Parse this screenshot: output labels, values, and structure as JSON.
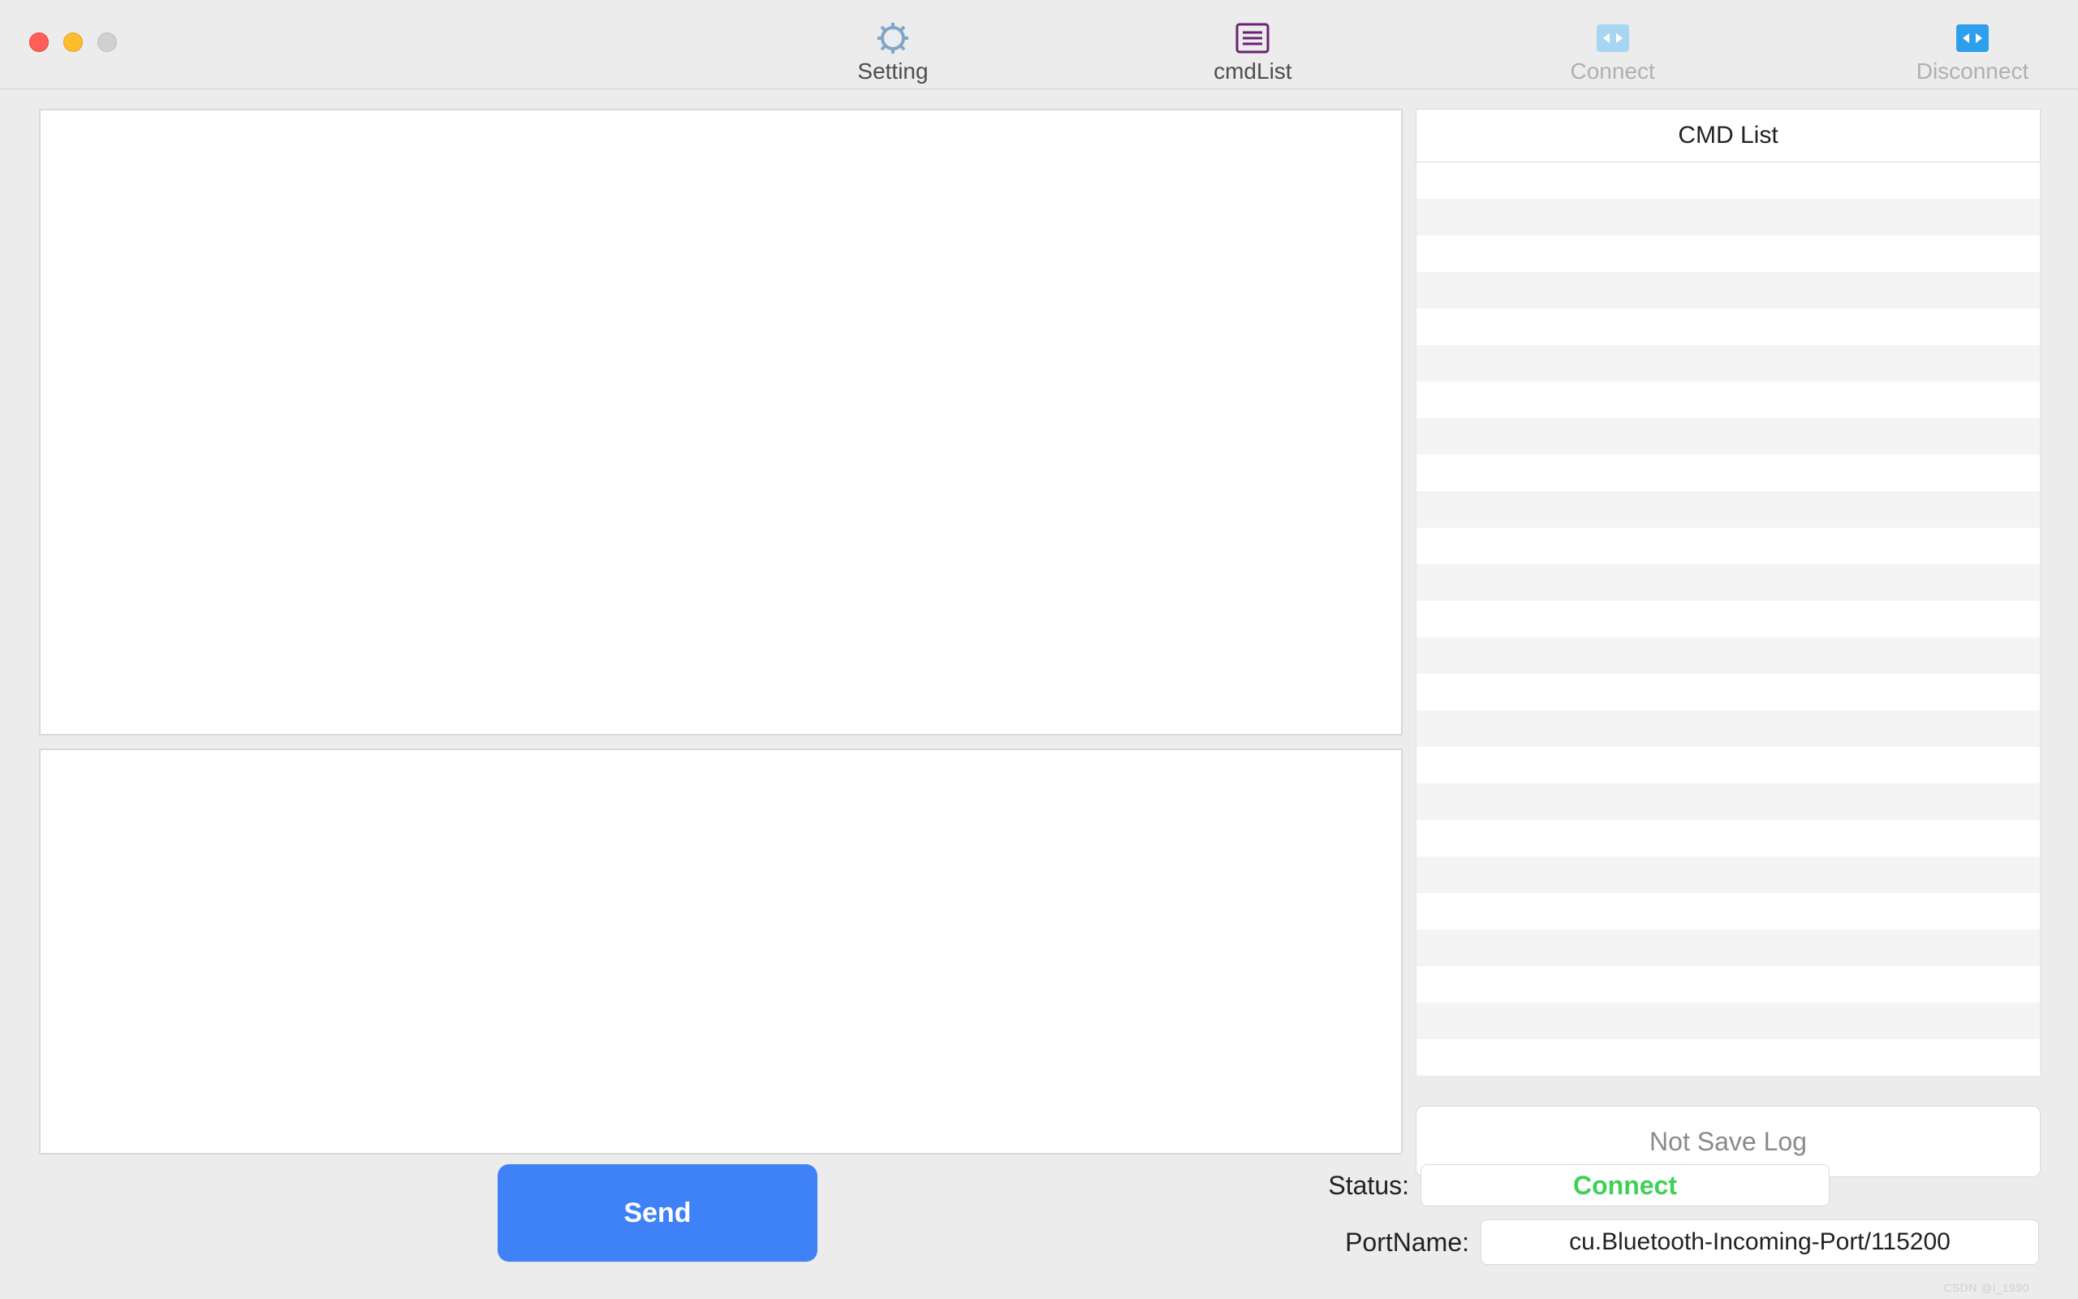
{
  "toolbar": {
    "setting_label": "Setting",
    "cmdlist_label": "cmdList",
    "connect_label": "Connect",
    "disconnect_label": "Disconnect"
  },
  "cmdlist_panel": {
    "header": "CMD List",
    "row_count": 25
  },
  "received_text": "",
  "send_text": "",
  "not_save_log_label": "Not Save Log",
  "send_button_label": "Send",
  "status": {
    "label": "Status:",
    "value": "Connect",
    "color": "#3ED155"
  },
  "portname": {
    "label": "PortName:",
    "value": "cu.Bluetooth-Incoming-Port/115200"
  },
  "watermark": "CSDN @i_1990",
  "icons": {
    "setting": "gear-icon",
    "cmdlist": "list-icon",
    "connect": "connect-icon",
    "disconnect": "disconnect-icon"
  },
  "colors": {
    "accent_blue": "#3F82F7",
    "cmdlist_border": "#6B2173",
    "connect_tile": "#A6D6F2",
    "disconnect_tile": "#2E9FEA"
  }
}
